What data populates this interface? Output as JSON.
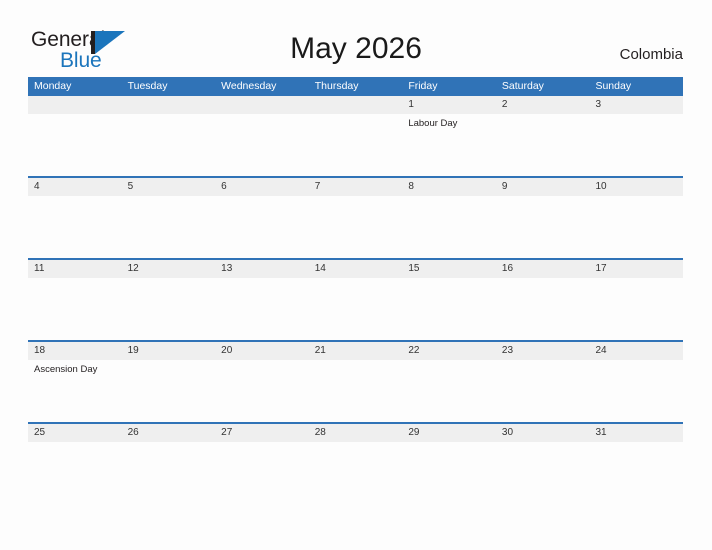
{
  "brand": {
    "name_part1": "General",
    "name_part2": "Blue",
    "mark_color": "#1b75bc",
    "text_color": "#231f20"
  },
  "header": {
    "title": "May 2026",
    "locale": "Colombia"
  },
  "calendar": {
    "header_color": "#3073b7",
    "date_band_color": "#efefef",
    "weekdays": [
      "Monday",
      "Tuesday",
      "Wednesday",
      "Thursday",
      "Friday",
      "Saturday",
      "Sunday"
    ],
    "weeks": [
      {
        "days": [
          {
            "date": "",
            "events": []
          },
          {
            "date": "",
            "events": []
          },
          {
            "date": "",
            "events": []
          },
          {
            "date": "",
            "events": []
          },
          {
            "date": "1",
            "events": [
              "Labour Day"
            ]
          },
          {
            "date": "2",
            "events": []
          },
          {
            "date": "3",
            "events": []
          }
        ]
      },
      {
        "days": [
          {
            "date": "4",
            "events": []
          },
          {
            "date": "5",
            "events": []
          },
          {
            "date": "6",
            "events": []
          },
          {
            "date": "7",
            "events": []
          },
          {
            "date": "8",
            "events": []
          },
          {
            "date": "9",
            "events": []
          },
          {
            "date": "10",
            "events": []
          }
        ]
      },
      {
        "days": [
          {
            "date": "11",
            "events": []
          },
          {
            "date": "12",
            "events": []
          },
          {
            "date": "13",
            "events": []
          },
          {
            "date": "14",
            "events": []
          },
          {
            "date": "15",
            "events": []
          },
          {
            "date": "16",
            "events": []
          },
          {
            "date": "17",
            "events": []
          }
        ]
      },
      {
        "days": [
          {
            "date": "18",
            "events": [
              "Ascension Day"
            ]
          },
          {
            "date": "19",
            "events": []
          },
          {
            "date": "20",
            "events": []
          },
          {
            "date": "21",
            "events": []
          },
          {
            "date": "22",
            "events": []
          },
          {
            "date": "23",
            "events": []
          },
          {
            "date": "24",
            "events": []
          }
        ]
      },
      {
        "days": [
          {
            "date": "25",
            "events": []
          },
          {
            "date": "26",
            "events": []
          },
          {
            "date": "27",
            "events": []
          },
          {
            "date": "28",
            "events": []
          },
          {
            "date": "29",
            "events": []
          },
          {
            "date": "30",
            "events": []
          },
          {
            "date": "31",
            "events": []
          }
        ]
      }
    ]
  }
}
